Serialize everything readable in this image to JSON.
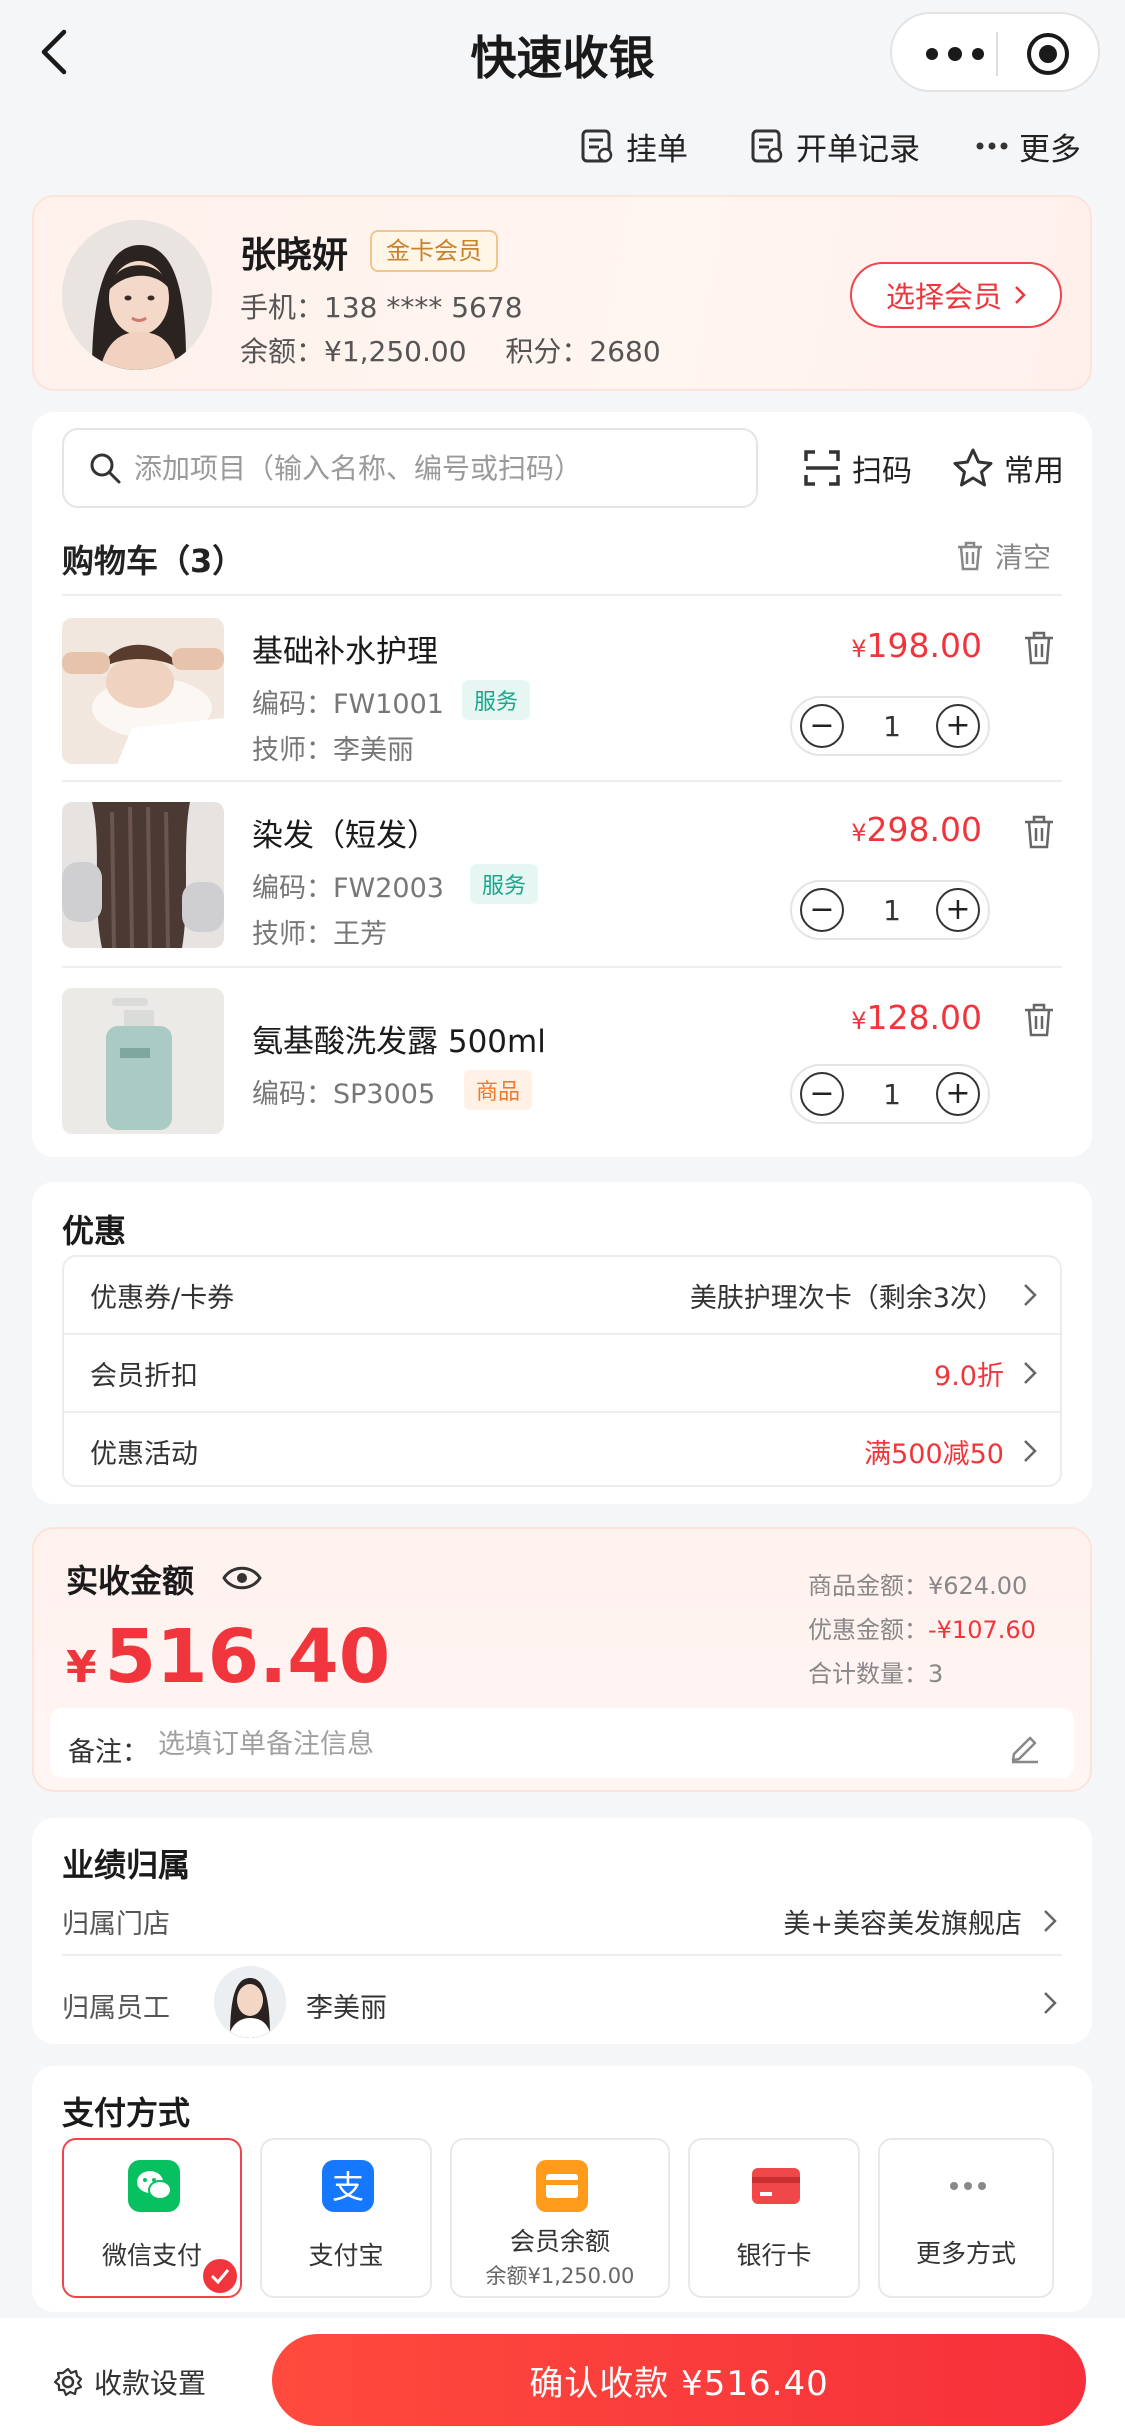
{
  "header": {
    "title": "快速收银"
  },
  "toolbar": {
    "hold_label": "挂单",
    "records_label": "开单记录",
    "more_label": "更多"
  },
  "member": {
    "name": "张晓妍",
    "badge": "金卡会员",
    "phone": "手机：138 **** 5678",
    "balance": "余额：¥1,250.00",
    "points": "积分：2680",
    "select_button": "选择会员"
  },
  "search": {
    "placeholder": "添加项目（输入名称、编号或扫码）",
    "scan_label": "扫码",
    "favorites_label": "常用"
  },
  "cart": {
    "title": "购物车（3）",
    "clear_label": "清空",
    "items": [
      {
        "name": "基础补水护理",
        "code": "编码：FW1001",
        "tag": "服务",
        "technician": "技师：李美丽",
        "currency": "¥",
        "price": "198.00",
        "qty": "1"
      },
      {
        "name": "染发（短发）",
        "code": "编码：FW2003",
        "tag": "服务",
        "technician": "技师：王芳",
        "currency": "¥",
        "price": "298.00",
        "qty": "1"
      },
      {
        "name": "氨基酸洗发露 500ml",
        "code": "编码：SP3005",
        "tag": "商品",
        "currency": "¥",
        "price": "128.00",
        "qty": "1"
      }
    ]
  },
  "discounts": {
    "title": "优惠",
    "rows": [
      {
        "label": "优惠券/卡券",
        "value": "美肤护理次卡（剩余3次）"
      },
      {
        "label": "会员折扣",
        "value": "9.0折"
      },
      {
        "label": "优惠活动",
        "value": "满500减50"
      }
    ]
  },
  "amount": {
    "label": "实收金额",
    "currency": "¥",
    "value": "516.40",
    "goods_amount": "商品金额：¥624.00",
    "discount_amount_label": "优惠金额：",
    "discount_amount_value": "-¥107.60",
    "total_qty": "合计数量：3",
    "remark_label": "备注：",
    "remark_placeholder": "选填订单备注信息"
  },
  "attribution": {
    "title": "业绩归属",
    "store_label": "归属门店",
    "store_value": "美+美容美发旗舰店",
    "staff_label": "归属员工",
    "staff_value": "李美丽"
  },
  "payment": {
    "title": "支付方式",
    "methods": [
      {
        "label": "微信支付"
      },
      {
        "label": "支付宝"
      },
      {
        "label": "会员余额",
        "sub": "余额¥1,250.00"
      },
      {
        "label": "银行卡"
      },
      {
        "label": "更多方式"
      }
    ]
  },
  "footer": {
    "settings_label": "收款设置",
    "confirm_label": "确认收款 ¥516.40"
  },
  "colors": {
    "accent": "#f0363c",
    "wechat": "#07c160",
    "alipay": "#1677ff",
    "balance": "#ff9b1a",
    "bank": "#f04848",
    "service_tag": "#1ba58b",
    "goods_tag": "#f07a2a"
  }
}
